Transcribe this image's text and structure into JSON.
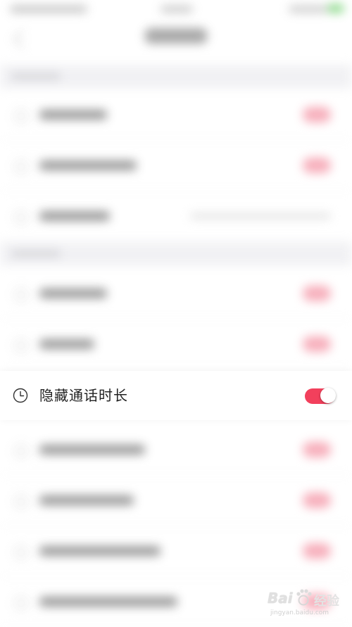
{
  "focused_setting": {
    "label": "隐藏通话时长",
    "icon": "clock-icon",
    "toggle_on": true,
    "accent_color": "#f2405c"
  },
  "watermark": {
    "brand": "Bai",
    "brand_cn": "经验",
    "url": "jingyan.baidu.com"
  }
}
